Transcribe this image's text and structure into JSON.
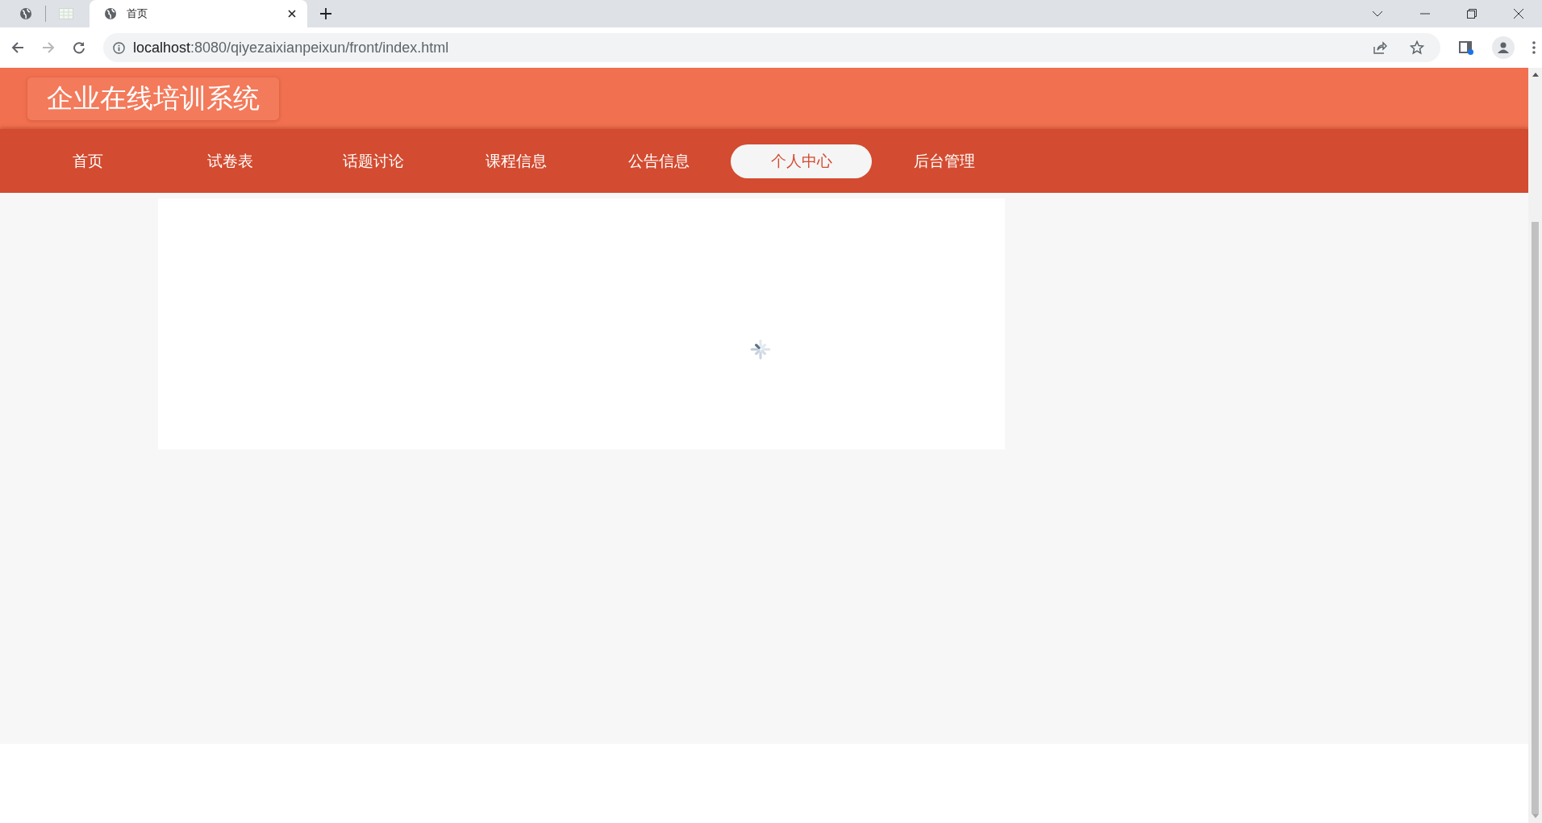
{
  "browser": {
    "tabs": [
      {
        "kind": "globe",
        "selected": false
      },
      {
        "kind": "sheet",
        "selected": false
      },
      {
        "kind": "globe",
        "title": "首页",
        "selected": true
      }
    ],
    "url_host": "localhost",
    "url_rest": ":8080/qiyezaixianpeixun/front/index.html"
  },
  "site": {
    "title": "企业在线培训系统"
  },
  "nav": [
    {
      "label": "首页",
      "selected": false
    },
    {
      "label": "试卷表",
      "selected": false
    },
    {
      "label": "话题讨论",
      "selected": false
    },
    {
      "label": "课程信息",
      "selected": false
    },
    {
      "label": "公告信息",
      "selected": false
    },
    {
      "label": "个人中心",
      "selected": true
    },
    {
      "label": "后台管理",
      "selected": false
    }
  ]
}
